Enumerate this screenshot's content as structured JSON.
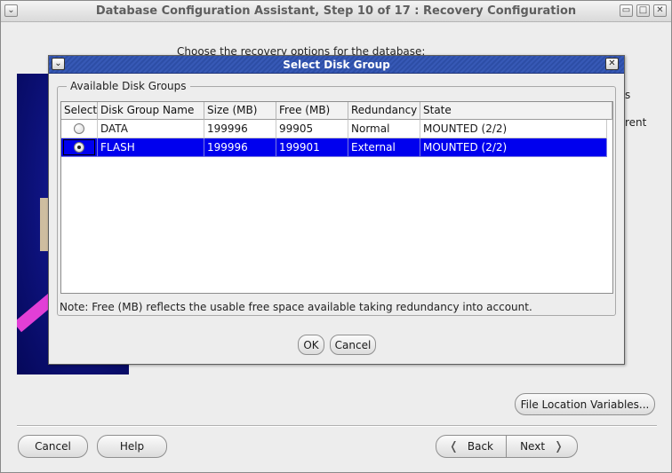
{
  "main_window": {
    "title": "Database Configuration Assistant, Step 10 of 17 : Recovery Configuration",
    "window_controls": {
      "menu": "⌄",
      "minimize": "▭",
      "maximize": "□",
      "close": "✕"
    },
    "instruction": "Choose the recovery options for the database:",
    "partial_text_1": "s",
    "partial_text_2": "rent",
    "file_location_button": "File Location Variables...",
    "buttons": {
      "cancel": "Cancel",
      "help": "Help",
      "back": "Back",
      "next": "Next"
    }
  },
  "dialog": {
    "title": "Select Disk Group",
    "frame_legend": "Available Disk Groups",
    "columns": [
      "Select",
      "Disk Group Name",
      "Size (MB)",
      "Free (MB)",
      "Redundancy",
      "State"
    ],
    "rows": [
      {
        "name": "DATA",
        "size": "199996",
        "free": "99905",
        "redundancy": "Normal",
        "state": "MOUNTED (2/2)",
        "selected": false
      },
      {
        "name": "FLASH",
        "size": "199996",
        "free": "199901",
        "redundancy": "External",
        "state": "MOUNTED (2/2)",
        "selected": true
      }
    ],
    "note": "Note:  Free (MB) reflects the usable free space available taking redundancy into account.",
    "ok_label": "OK",
    "cancel_label": "Cancel"
  },
  "colors": {
    "selection": "#0000ee",
    "dialog_titlebar": "#3759b6"
  },
  "icons": {
    "back": "chevron-left-icon",
    "next": "chevron-right-icon"
  }
}
